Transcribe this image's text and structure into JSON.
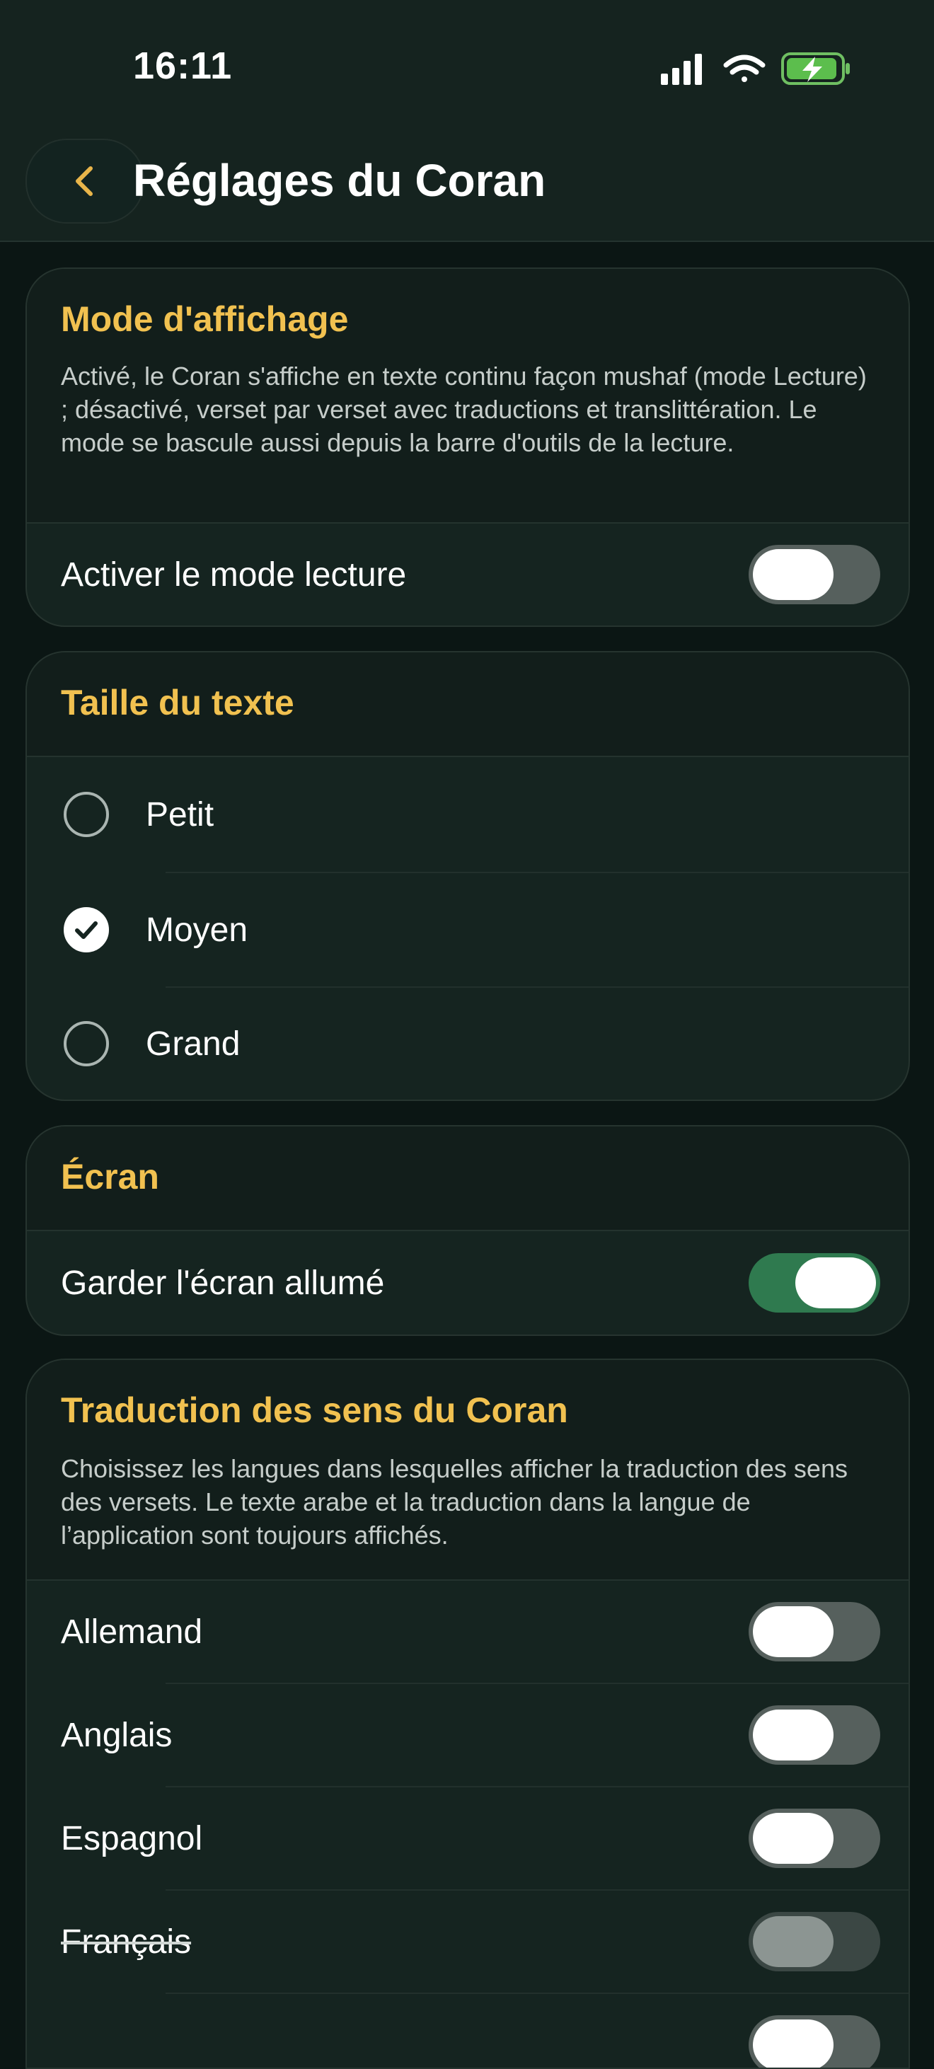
{
  "status_bar": {
    "time": "16:11"
  },
  "header": {
    "title": "Réglages du Coran",
    "back_icon": "chevron-left-icon",
    "accent": "#e9b54a"
  },
  "display_mode": {
    "title": "Mode d'affichage",
    "description": "Activé, le Coran s'affiche en texte continu façon mushaf (mode Lecture) ; désactivé, verset par verset avec traductions et translittération. Le mode se bascule aussi depuis la barre d'outils de la lecture.",
    "toggle_label": "Activer le mode lecture",
    "toggle_on": false
  },
  "text_size": {
    "title": "Taille du texte",
    "options": [
      {
        "label": "Petit",
        "selected": false
      },
      {
        "label": "Moyen",
        "selected": true
      },
      {
        "label": "Grand",
        "selected": false
      }
    ]
  },
  "screen": {
    "title": "Écran",
    "toggle_label": "Garder l'écran allumé",
    "toggle_on": true
  },
  "translation": {
    "title": "Traduction des sens du Coran",
    "description": "Choisissez les langues dans lesquelles afficher la traduction des sens des versets. Le texte arabe et la traduction dans la langue de l’application sont toujours affichés.",
    "languages": [
      {
        "label": "Allemand",
        "on": false
      },
      {
        "label": "Anglais",
        "on": false
      },
      {
        "label": "Espagnol",
        "on": false
      },
      {
        "label": "Français",
        "on": false,
        "disabled": true
      }
    ]
  },
  "colors": {
    "title_accent": "#f1c150",
    "toggle_on": "#2f7a4f",
    "background": "#0b1614"
  }
}
